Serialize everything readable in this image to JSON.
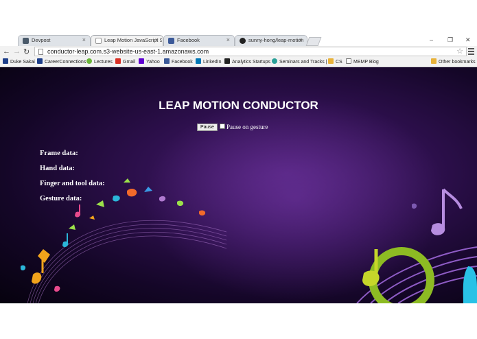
{
  "browser": {
    "tabs": [
      {
        "title": "Devpost",
        "active": false
      },
      {
        "title": "Leap Motion JavaScript S",
        "active": true
      },
      {
        "title": "Facebook",
        "active": false
      },
      {
        "title": "sunny-hong/leap-motion",
        "active": false
      }
    ],
    "address": "conductor-leap.com.s3-website-us-east-1.amazonaws.com",
    "window_controls": [
      "–",
      "❐",
      "✕"
    ]
  },
  "bookmarks": [
    {
      "label": "Duke Sakai",
      "color": "#1e3f8a"
    },
    {
      "label": "CareerConnections",
      "color": "#1e3f8a"
    },
    {
      "label": "Lectures",
      "color": "#6bb53a"
    },
    {
      "label": "Gmail",
      "color": "#d93025"
    },
    {
      "label": "Yahoo",
      "color": "#5f01d1"
    },
    {
      "label": "Facebook",
      "color": "#3b5998"
    },
    {
      "label": "LinkedIn",
      "color": "#0077b5"
    },
    {
      "label": "Analytics Startups",
      "color": "#222222"
    },
    {
      "label": "Seminars and Tracks |",
      "color": "#2aa198"
    },
    {
      "label": "CS",
      "color": "#e8b23a"
    },
    {
      "label": "MEMP Blog",
      "color": "#ffffff"
    }
  ],
  "other_bookmarks": "Other bookmarks",
  "page": {
    "title": "LEAP MOTION CONDUCTOR",
    "pause_button": "Pause",
    "pause_on_gesture": "Pause on gesture",
    "labels": {
      "frame": "Frame data:",
      "hand": "Hand data:",
      "finger": "Finger and tool data:",
      "gesture": "Gesture data:"
    }
  }
}
